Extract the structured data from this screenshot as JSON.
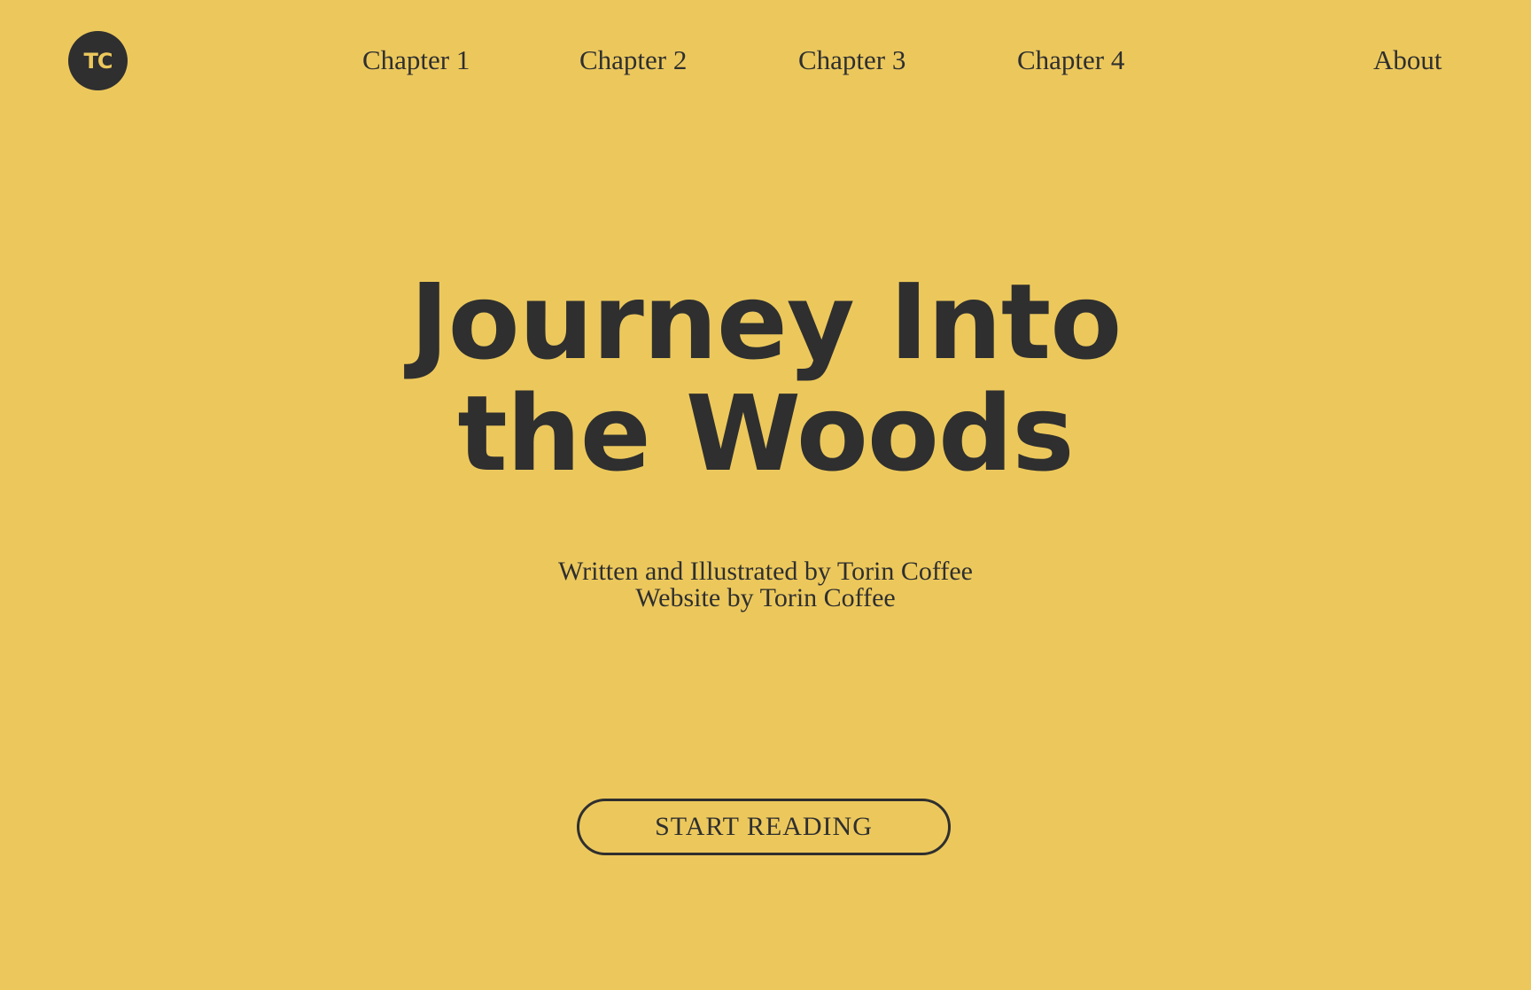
{
  "nav": {
    "logo_text": "TC",
    "links": [
      {
        "label": "Chapter 1"
      },
      {
        "label": "Chapter 2"
      },
      {
        "label": "Chapter 3"
      },
      {
        "label": "Chapter 4"
      }
    ],
    "about_label": "About"
  },
  "hero": {
    "title_line1": "Journey Into",
    "title_line2": "the Woods",
    "credit_line1": "Written and Illustrated by Torin Coffee",
    "credit_line2": "Website by Torin Coffee",
    "cta_label": "START READING"
  },
  "colors": {
    "background": "#ecc85c",
    "text": "#2f2f2f"
  }
}
